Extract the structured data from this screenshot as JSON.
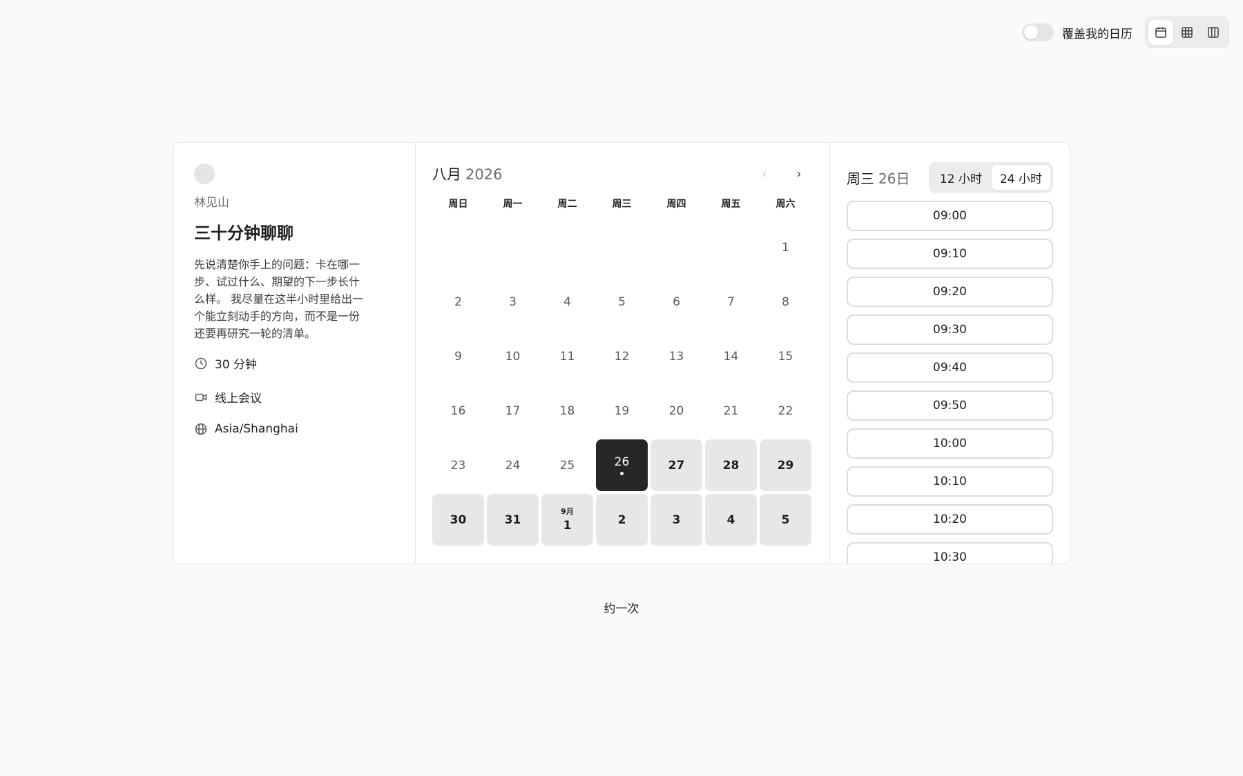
{
  "toolbar": {
    "overlay_label": "覆盖我的日历",
    "overlay_on": false,
    "views": [
      {
        "name": "month-view-button",
        "icon": "calendar-icon",
        "active": true
      },
      {
        "name": "week-view-button",
        "icon": "grid-icon",
        "active": false
      },
      {
        "name": "column-view-button",
        "icon": "columns-icon",
        "active": false
      }
    ]
  },
  "event": {
    "host": "林见山",
    "title": "三十分钟聊聊",
    "description_lines": [
      "先说清楚你手上的问题：卡在哪一",
      "步、试过什么、期望的下一步长什",
      "么样。 我尽量在这半小时里给出一",
      "个能立刻动手的方向，而不是一份",
      "还要再研究一轮的清单。"
    ],
    "duration": "30 分钟",
    "location": "线上会议",
    "timezone": "Asia/Shanghai"
  },
  "calendar": {
    "month": "八月",
    "year": "2026",
    "prev_label": "‹",
    "next_label": "›",
    "weekdays": [
      "周日",
      "周一",
      "周二",
      "周三",
      "周四",
      "周五",
      "周六"
    ],
    "days": [
      {
        "label": "",
        "state": "empty"
      },
      {
        "label": "",
        "state": "empty"
      },
      {
        "label": "",
        "state": "empty"
      },
      {
        "label": "",
        "state": "empty"
      },
      {
        "label": "",
        "state": "empty"
      },
      {
        "label": "",
        "state": "empty"
      },
      {
        "label": "1",
        "state": "off"
      },
      {
        "label": "2",
        "state": "off"
      },
      {
        "label": "3",
        "state": "off"
      },
      {
        "label": "4",
        "state": "off"
      },
      {
        "label": "5",
        "state": "off"
      },
      {
        "label": "6",
        "state": "off"
      },
      {
        "label": "7",
        "state": "off"
      },
      {
        "label": "8",
        "state": "off"
      },
      {
        "label": "9",
        "state": "off"
      },
      {
        "label": "10",
        "state": "off"
      },
      {
        "label": "11",
        "state": "off"
      },
      {
        "label": "12",
        "state": "off"
      },
      {
        "label": "13",
        "state": "off"
      },
      {
        "label": "14",
        "state": "off"
      },
      {
        "label": "15",
        "state": "off"
      },
      {
        "label": "16",
        "state": "off"
      },
      {
        "label": "17",
        "state": "off"
      },
      {
        "label": "18",
        "state": "off"
      },
      {
        "label": "19",
        "state": "off"
      },
      {
        "label": "20",
        "state": "off"
      },
      {
        "label": "21",
        "state": "off"
      },
      {
        "label": "22",
        "state": "off"
      },
      {
        "label": "23",
        "state": "off"
      },
      {
        "label": "24",
        "state": "off"
      },
      {
        "label": "25",
        "state": "off"
      },
      {
        "label": "26",
        "state": "selected"
      },
      {
        "label": "27",
        "state": "avail"
      },
      {
        "label": "28",
        "state": "avail"
      },
      {
        "label": "29",
        "state": "avail"
      },
      {
        "label": "30",
        "state": "avail"
      },
      {
        "label": "31",
        "state": "avail"
      },
      {
        "label": "1",
        "month_label": "9月",
        "state": "avail"
      },
      {
        "label": "2",
        "state": "avail"
      },
      {
        "label": "3",
        "state": "avail"
      },
      {
        "label": "4",
        "state": "avail"
      },
      {
        "label": "5",
        "state": "avail"
      }
    ]
  },
  "slots": {
    "weekday": "周三",
    "date": "26日",
    "format_12": "12 小时",
    "format_24": "24 小时",
    "active_format": "24",
    "times": [
      "09:00",
      "09:10",
      "09:20",
      "09:30",
      "09:40",
      "09:50",
      "10:00",
      "10:10",
      "10:20",
      "10:30"
    ]
  },
  "footer": {
    "link": "约一次"
  }
}
